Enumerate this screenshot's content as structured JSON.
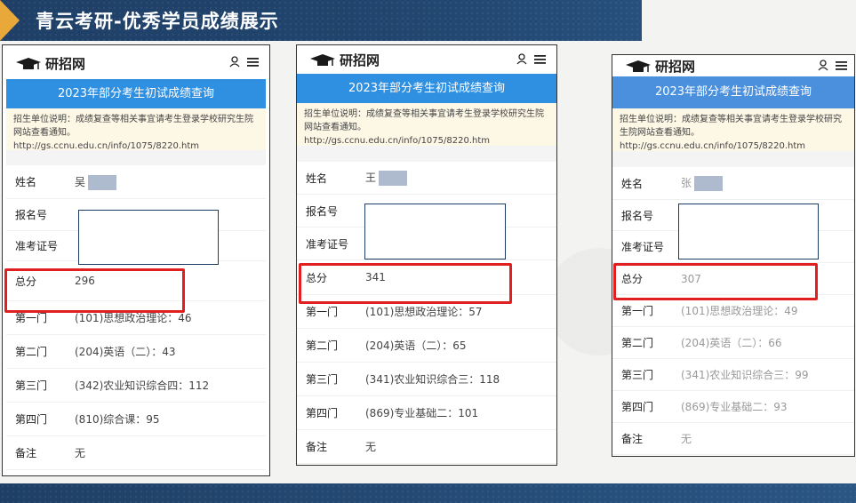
{
  "header": {
    "title": "青云考研-优秀学员成绩展示"
  },
  "common": {
    "logo_text": "研招网",
    "banner": "2023年部分考生初试成绩查询",
    "labels": {
      "name": "姓名",
      "reg_no": "报名号",
      "exam_no": "准考证号",
      "total": "总分",
      "s1": "第一门",
      "s2": "第二门",
      "s3": "第三门",
      "s4": "第四门",
      "note": "备注"
    }
  },
  "cards": [
    {
      "notice": "招生单位说明：成绩复查等相关事宜请考生登录学校研究生院网站查看通知。http://gs.ccnu.edu.cn/info/1075/8220.htm",
      "surname": "吴",
      "total": "296",
      "s1": "(101)思想政治理论：46",
      "s2": "(204)英语（二）：43",
      "s3": "(342)农业知识综合四：112",
      "s4": "(810)综合课：95",
      "note": "无"
    },
    {
      "notice": "招生单位说明：成绩复查等相关事宜请考生登录学校研究生院网站查看通知。http://gs.ccnu.edu.cn/info/1075/8220.htm",
      "surname": "王",
      "total": "341",
      "s1": "(101)思想政治理论：57",
      "s2": "(204)英语（二）：65",
      "s3": "(341)农业知识综合三：118",
      "s4": "(869)专业基础二：101",
      "note": "无"
    },
    {
      "notice": "招生单位说明：成绩复查等相关事宜请考生登录学校研究生院网站查看通知。http://gs.ccnu.edu.cn/info/1075/8220.htm",
      "surname": "张",
      "total": "307",
      "s1": "(101)思想政治理论：49",
      "s2": "(204)英语（二）：66",
      "s3": "(341)农业知识综合三：99",
      "s4": "(869)专业基础二：93",
      "note": "无"
    }
  ],
  "colors": {
    "banner_blue": "#2f8fe0",
    "banner_blue_3": "#4a90dc",
    "highlight_red": "#e02020",
    "header_navy": "#1f3f66",
    "accent_orange": "#e8a83a"
  }
}
